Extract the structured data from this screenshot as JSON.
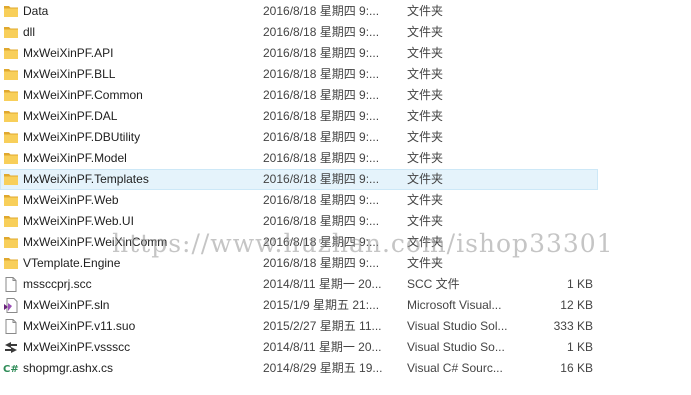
{
  "files": [
    {
      "name": "Data",
      "date": "2016/8/18",
      "day": "星期四 9:...",
      "type": "文件夹",
      "size": "",
      "icon": "folder-icon"
    },
    {
      "name": "dll",
      "date": "2016/8/18",
      "day": "星期四 9:...",
      "type": "文件夹",
      "size": "",
      "icon": "folder-icon"
    },
    {
      "name": "MxWeiXinPF.API",
      "date": "2016/8/18",
      "day": "星期四 9:...",
      "type": "文件夹",
      "size": "",
      "icon": "folder-icon"
    },
    {
      "name": "MxWeiXinPF.BLL",
      "date": "2016/8/18",
      "day": "星期四 9:...",
      "type": "文件夹",
      "size": "",
      "icon": "folder-icon"
    },
    {
      "name": "MxWeiXinPF.Common",
      "date": "2016/8/18",
      "day": "星期四 9:...",
      "type": "文件夹",
      "size": "",
      "icon": "folder-icon"
    },
    {
      "name": "MxWeiXinPF.DAL",
      "date": "2016/8/18",
      "day": "星期四 9:...",
      "type": "文件夹",
      "size": "",
      "icon": "folder-icon"
    },
    {
      "name": "MxWeiXinPF.DBUtility",
      "date": "2016/8/18",
      "day": "星期四 9:...",
      "type": "文件夹",
      "size": "",
      "icon": "folder-icon"
    },
    {
      "name": "MxWeiXinPF.Model",
      "date": "2016/8/18",
      "day": "星期四 9:...",
      "type": "文件夹",
      "size": "",
      "icon": "folder-icon"
    },
    {
      "name": "MxWeiXinPF.Templates",
      "date": "2016/8/18",
      "day": "星期四 9:...",
      "type": "文件夹",
      "size": "",
      "icon": "folder-icon",
      "selected": true
    },
    {
      "name": "MxWeiXinPF.Web",
      "date": "2016/8/18",
      "day": "星期四 9:...",
      "type": "文件夹",
      "size": "",
      "icon": "folder-icon"
    },
    {
      "name": "MxWeiXinPF.Web.UI",
      "date": "2016/8/18",
      "day": "星期四 9:...",
      "type": "文件夹",
      "size": "",
      "icon": "folder-icon"
    },
    {
      "name": "MxWeiXinPF.WeiXinComm",
      "date": "2016/8/18",
      "day": "星期四 9:...",
      "type": "文件夹",
      "size": "",
      "icon": "folder-icon"
    },
    {
      "name": "VTemplate.Engine",
      "date": "2016/8/18",
      "day": "星期四 9:...",
      "type": "文件夹",
      "size": "",
      "icon": "folder-icon"
    },
    {
      "name": "mssccprj.scc",
      "date": "2014/8/11",
      "day": "星期一 20...",
      "type": "SCC 文件",
      "size": "1 KB",
      "icon": "document-icon"
    },
    {
      "name": "MxWeiXinPF.sln",
      "date": "2015/1/9",
      "day": "星期五 21:...",
      "type": "Microsoft Visual...",
      "size": "12 KB",
      "icon": "visual-studio-solution-icon"
    },
    {
      "name": "MxWeiXinPF.v11.suo",
      "date": "2015/2/27",
      "day": "星期五 11...",
      "type": "Visual Studio Sol...",
      "size": "333 KB",
      "icon": "document-icon"
    },
    {
      "name": "MxWeiXinPF.vssscc",
      "date": "2014/8/11",
      "day": "星期一 20...",
      "type": "Visual Studio So...",
      "size": "1 KB",
      "icon": "source-control-icon"
    },
    {
      "name": "shopmgr.ashx.cs",
      "date": "2014/8/29",
      "day": "星期五 19...",
      "type": "Visual C# Sourc...",
      "size": "16 KB",
      "icon": "csharp-file-icon"
    }
  ],
  "watermark": "https://www.huzhan.com/ishop33301",
  "colors": {
    "folder": "#f5c84c",
    "folder_dark": "#e0a82e",
    "selection": "#e5f3fb",
    "csharp": "#2e8b57"
  }
}
